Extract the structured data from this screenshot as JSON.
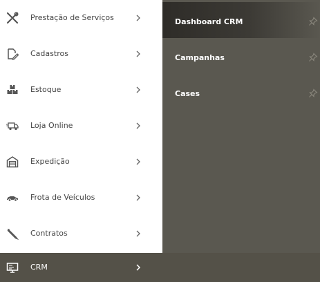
{
  "menu": {
    "items": [
      {
        "label": "Prestação de Serviços",
        "icon": "tools-icon"
      },
      {
        "label": "Cadastros",
        "icon": "edit-document-icon"
      },
      {
        "label": "Estoque",
        "icon": "boxes-icon"
      },
      {
        "label": "Loja Online",
        "icon": "delivery-truck-icon"
      },
      {
        "label": "Expedição",
        "icon": "warehouse-icon"
      },
      {
        "label": "Frota de Veículos",
        "icon": "car-icon"
      },
      {
        "label": "Contratos",
        "icon": "pen-icon"
      },
      {
        "label": "CRM",
        "icon": "monitor-icon"
      }
    ],
    "active_item": "CRM"
  },
  "submenu": {
    "items": [
      {
        "label": "Dashboard CRM",
        "highlighted": true
      },
      {
        "label": "Campanhas",
        "highlighted": false
      },
      {
        "label": "Cases",
        "highlighted": false
      }
    ]
  },
  "colors": {
    "menu_text": "#444444",
    "active_bg": "#545148",
    "submenu_bg": "#5a5850",
    "submenu_highlight": "#2e2c28",
    "submenu_text": "#ffffff",
    "icon_color": "#555555",
    "pin_color": "#8a877d"
  }
}
